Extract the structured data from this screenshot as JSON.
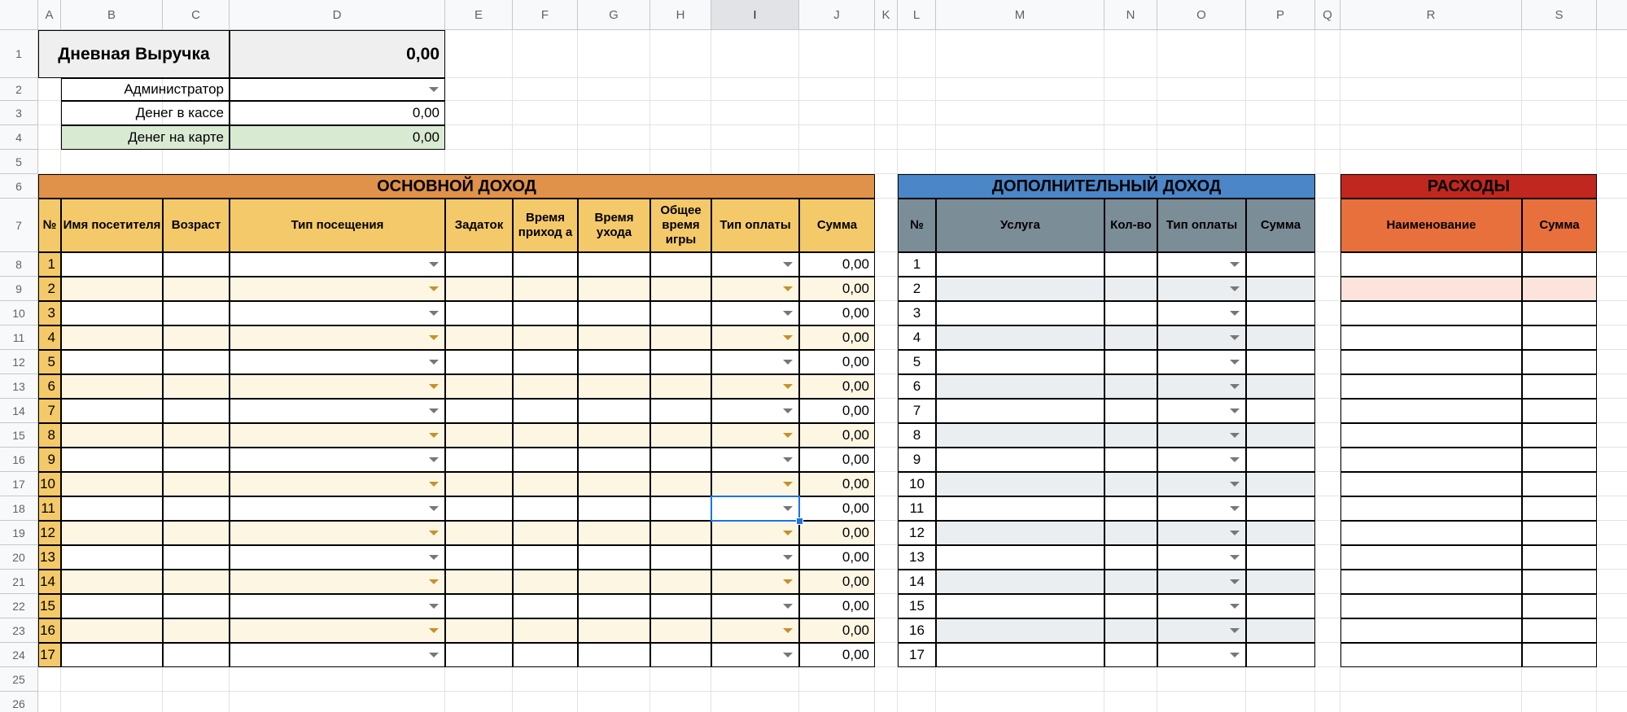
{
  "columns": [
    "A",
    "B",
    "C",
    "D",
    "E",
    "F",
    "G",
    "H",
    "I",
    "J",
    "K",
    "L",
    "M",
    "N",
    "O",
    "P",
    "Q",
    "R",
    "S"
  ],
  "selected_column": "I",
  "summary": {
    "title": "Дневная Выручка",
    "total": "0,00",
    "admin_label": "Администратор",
    "cash_label": "Денег в кассе",
    "cash_value": "0,00",
    "card_label": "Денег на карте",
    "card_value": "0,00"
  },
  "main_income": {
    "title": "ОСНОВНОЙ ДОХОД",
    "headers": [
      "№",
      "Имя посетителя",
      "Возраст",
      "Тип посещения",
      "Задаток",
      "Время приход а",
      "Время ухода",
      "Общее время игры",
      "Тип оплаты",
      "Сумма"
    ],
    "sum_value": "0,00"
  },
  "extra_income": {
    "title": "ДОПОЛНИТЕЛЬНЫЙ ДОХОД",
    "headers": [
      "№",
      "Услуга",
      "Кол-во",
      "Тип оплаты",
      "Сумма"
    ]
  },
  "expenses": {
    "title": "РАСХОДЫ",
    "headers": [
      "Наименование",
      "Сумма"
    ]
  },
  "row_numbers": [
    1,
    2,
    3,
    4,
    5,
    6,
    7,
    8,
    9,
    10,
    11,
    12,
    13,
    14,
    15,
    16,
    17,
    18,
    19,
    20,
    21,
    22,
    23,
    24,
    25,
    26
  ],
  "data_rows": [
    1,
    2,
    3,
    4,
    5,
    6,
    7,
    8,
    9,
    10,
    11,
    12,
    13,
    14,
    15,
    16,
    17
  ],
  "colors": {
    "orange_banner": "#e0924a",
    "main_header": "#f4c969",
    "main_stripe": "#fdf6e3",
    "extra_banner": "#4a86c8",
    "extra_header": "#7b8d97",
    "extra_stripe": "#eaeef1",
    "expense_banner": "#c1271f",
    "expense_header": "#e8703c",
    "expense_highlight": "#fce4dc",
    "summary_gray": "#efefef",
    "card_green": "#d9ead3",
    "selection": "#1a73e8"
  }
}
